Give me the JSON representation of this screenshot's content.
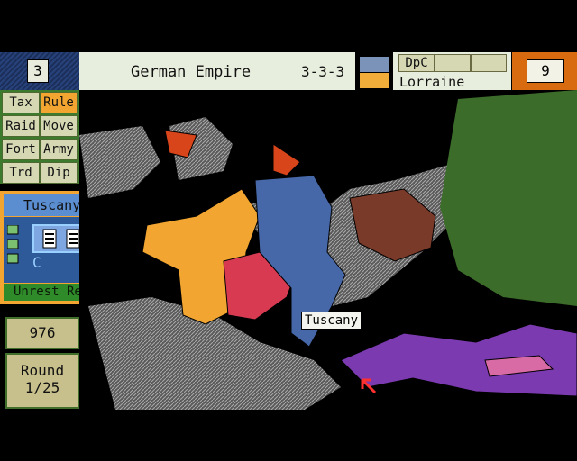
{
  "header": {
    "turn": "3",
    "empire": "German Empire",
    "stats": "3-3-3",
    "dpc_label": "DpC",
    "region": "Lorraine",
    "counter": "9"
  },
  "commands": [
    {
      "label": "Tax",
      "active": false
    },
    {
      "label": "Rule",
      "active": true
    },
    {
      "label": "Raid",
      "active": false
    },
    {
      "label": "Move",
      "active": false
    },
    {
      "label": "Fort",
      "active": false
    },
    {
      "label": "Army",
      "active": false
    },
    {
      "label": "Trd",
      "active": false
    },
    {
      "label": "Dip",
      "active": false
    }
  ],
  "province_panel": {
    "name": "Tuscany",
    "code": "C",
    "value_top": "1",
    "value_bottom": "0",
    "status": "Unrest Removed"
  },
  "treasury": "976",
  "round": {
    "label": "Round",
    "value": "1/25"
  },
  "map": {
    "label": "Tuscany",
    "colors": {
      "player": "#f2a631",
      "blue": "#4667a8",
      "red": "#d83a52",
      "brown": "#7a3a2a",
      "green": "#3c6c2a",
      "purple": "#7b3ab0",
      "pink": "#d86aa5",
      "grey": "#8c8c8c"
    }
  }
}
